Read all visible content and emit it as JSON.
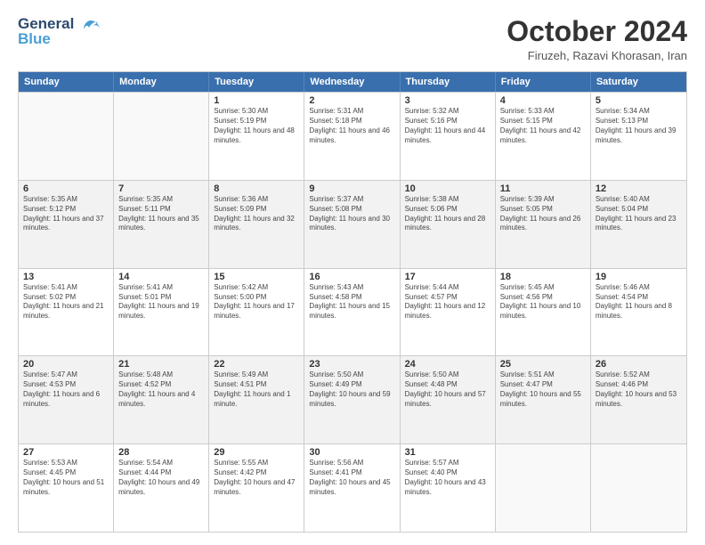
{
  "logo": {
    "line1": "General",
    "line2": "Blue"
  },
  "title": "October 2024",
  "location": "Firuzeh, Razavi Khorasan, Iran",
  "days": [
    "Sunday",
    "Monday",
    "Tuesday",
    "Wednesday",
    "Thursday",
    "Friday",
    "Saturday"
  ],
  "weeks": [
    [
      {
        "day": "",
        "sunrise": "",
        "sunset": "",
        "daylight": ""
      },
      {
        "day": "",
        "sunrise": "",
        "sunset": "",
        "daylight": ""
      },
      {
        "day": "1",
        "sunrise": "Sunrise: 5:30 AM",
        "sunset": "Sunset: 5:19 PM",
        "daylight": "Daylight: 11 hours and 48 minutes."
      },
      {
        "day": "2",
        "sunrise": "Sunrise: 5:31 AM",
        "sunset": "Sunset: 5:18 PM",
        "daylight": "Daylight: 11 hours and 46 minutes."
      },
      {
        "day": "3",
        "sunrise": "Sunrise: 5:32 AM",
        "sunset": "Sunset: 5:16 PM",
        "daylight": "Daylight: 11 hours and 44 minutes."
      },
      {
        "day": "4",
        "sunrise": "Sunrise: 5:33 AM",
        "sunset": "Sunset: 5:15 PM",
        "daylight": "Daylight: 11 hours and 42 minutes."
      },
      {
        "day": "5",
        "sunrise": "Sunrise: 5:34 AM",
        "sunset": "Sunset: 5:13 PM",
        "daylight": "Daylight: 11 hours and 39 minutes."
      }
    ],
    [
      {
        "day": "6",
        "sunrise": "Sunrise: 5:35 AM",
        "sunset": "Sunset: 5:12 PM",
        "daylight": "Daylight: 11 hours and 37 minutes."
      },
      {
        "day": "7",
        "sunrise": "Sunrise: 5:35 AM",
        "sunset": "Sunset: 5:11 PM",
        "daylight": "Daylight: 11 hours and 35 minutes."
      },
      {
        "day": "8",
        "sunrise": "Sunrise: 5:36 AM",
        "sunset": "Sunset: 5:09 PM",
        "daylight": "Daylight: 11 hours and 32 minutes."
      },
      {
        "day": "9",
        "sunrise": "Sunrise: 5:37 AM",
        "sunset": "Sunset: 5:08 PM",
        "daylight": "Daylight: 11 hours and 30 minutes."
      },
      {
        "day": "10",
        "sunrise": "Sunrise: 5:38 AM",
        "sunset": "Sunset: 5:06 PM",
        "daylight": "Daylight: 11 hours and 28 minutes."
      },
      {
        "day": "11",
        "sunrise": "Sunrise: 5:39 AM",
        "sunset": "Sunset: 5:05 PM",
        "daylight": "Daylight: 11 hours and 26 minutes."
      },
      {
        "day": "12",
        "sunrise": "Sunrise: 5:40 AM",
        "sunset": "Sunset: 5:04 PM",
        "daylight": "Daylight: 11 hours and 23 minutes."
      }
    ],
    [
      {
        "day": "13",
        "sunrise": "Sunrise: 5:41 AM",
        "sunset": "Sunset: 5:02 PM",
        "daylight": "Daylight: 11 hours and 21 minutes."
      },
      {
        "day": "14",
        "sunrise": "Sunrise: 5:41 AM",
        "sunset": "Sunset: 5:01 PM",
        "daylight": "Daylight: 11 hours and 19 minutes."
      },
      {
        "day": "15",
        "sunrise": "Sunrise: 5:42 AM",
        "sunset": "Sunset: 5:00 PM",
        "daylight": "Daylight: 11 hours and 17 minutes."
      },
      {
        "day": "16",
        "sunrise": "Sunrise: 5:43 AM",
        "sunset": "Sunset: 4:58 PM",
        "daylight": "Daylight: 11 hours and 15 minutes."
      },
      {
        "day": "17",
        "sunrise": "Sunrise: 5:44 AM",
        "sunset": "Sunset: 4:57 PM",
        "daylight": "Daylight: 11 hours and 12 minutes."
      },
      {
        "day": "18",
        "sunrise": "Sunrise: 5:45 AM",
        "sunset": "Sunset: 4:56 PM",
        "daylight": "Daylight: 11 hours and 10 minutes."
      },
      {
        "day": "19",
        "sunrise": "Sunrise: 5:46 AM",
        "sunset": "Sunset: 4:54 PM",
        "daylight": "Daylight: 11 hours and 8 minutes."
      }
    ],
    [
      {
        "day": "20",
        "sunrise": "Sunrise: 5:47 AM",
        "sunset": "Sunset: 4:53 PM",
        "daylight": "Daylight: 11 hours and 6 minutes."
      },
      {
        "day": "21",
        "sunrise": "Sunrise: 5:48 AM",
        "sunset": "Sunset: 4:52 PM",
        "daylight": "Daylight: 11 hours and 4 minutes."
      },
      {
        "day": "22",
        "sunrise": "Sunrise: 5:49 AM",
        "sunset": "Sunset: 4:51 PM",
        "daylight": "Daylight: 11 hours and 1 minute."
      },
      {
        "day": "23",
        "sunrise": "Sunrise: 5:50 AM",
        "sunset": "Sunset: 4:49 PM",
        "daylight": "Daylight: 10 hours and 59 minutes."
      },
      {
        "day": "24",
        "sunrise": "Sunrise: 5:50 AM",
        "sunset": "Sunset: 4:48 PM",
        "daylight": "Daylight: 10 hours and 57 minutes."
      },
      {
        "day": "25",
        "sunrise": "Sunrise: 5:51 AM",
        "sunset": "Sunset: 4:47 PM",
        "daylight": "Daylight: 10 hours and 55 minutes."
      },
      {
        "day": "26",
        "sunrise": "Sunrise: 5:52 AM",
        "sunset": "Sunset: 4:46 PM",
        "daylight": "Daylight: 10 hours and 53 minutes."
      }
    ],
    [
      {
        "day": "27",
        "sunrise": "Sunrise: 5:53 AM",
        "sunset": "Sunset: 4:45 PM",
        "daylight": "Daylight: 10 hours and 51 minutes."
      },
      {
        "day": "28",
        "sunrise": "Sunrise: 5:54 AM",
        "sunset": "Sunset: 4:44 PM",
        "daylight": "Daylight: 10 hours and 49 minutes."
      },
      {
        "day": "29",
        "sunrise": "Sunrise: 5:55 AM",
        "sunset": "Sunset: 4:42 PM",
        "daylight": "Daylight: 10 hours and 47 minutes."
      },
      {
        "day": "30",
        "sunrise": "Sunrise: 5:56 AM",
        "sunset": "Sunset: 4:41 PM",
        "daylight": "Daylight: 10 hours and 45 minutes."
      },
      {
        "day": "31",
        "sunrise": "Sunrise: 5:57 AM",
        "sunset": "Sunset: 4:40 PM",
        "daylight": "Daylight: 10 hours and 43 minutes."
      },
      {
        "day": "",
        "sunrise": "",
        "sunset": "",
        "daylight": ""
      },
      {
        "day": "",
        "sunrise": "",
        "sunset": "",
        "daylight": ""
      }
    ]
  ]
}
